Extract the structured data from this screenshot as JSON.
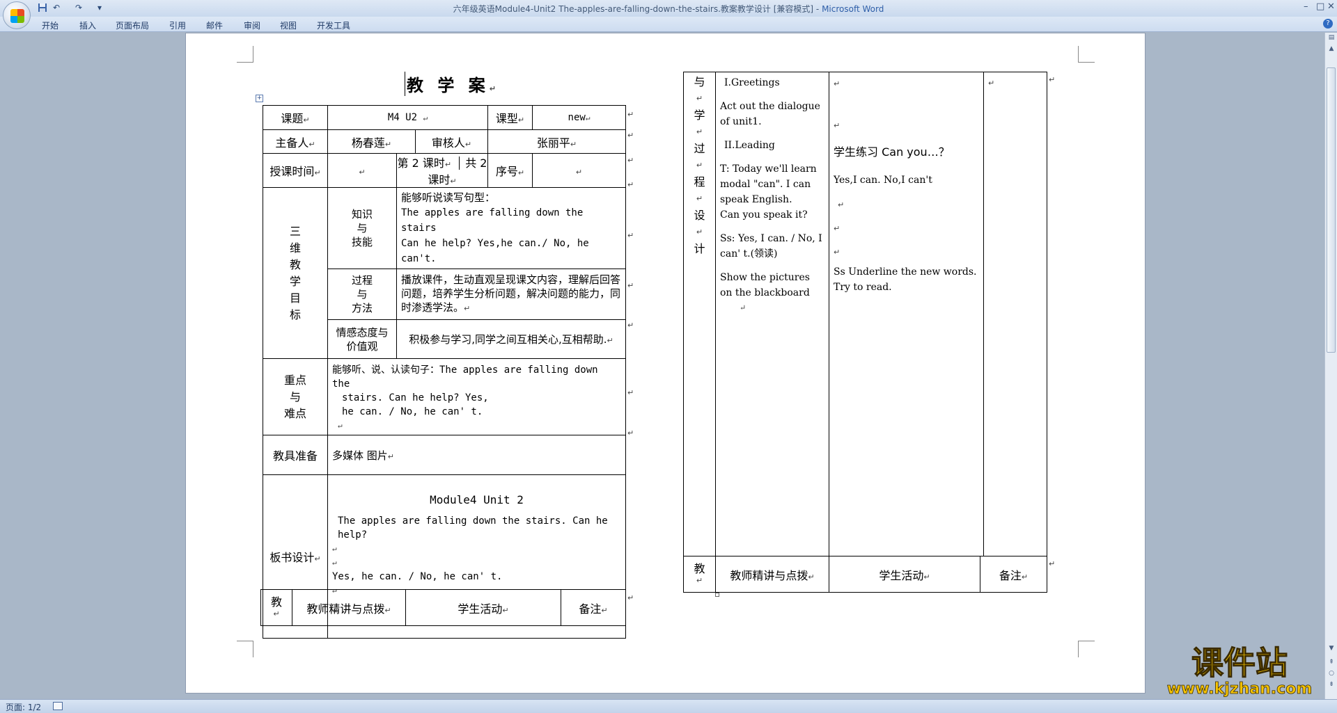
{
  "window": {
    "title_doc": "六年级英语Module4-Unit2 The-apples-are-falling-down-the-stairs.教案教学设计 [兼容模式] - ",
    "title_app": "Microsoft Word"
  },
  "quick_access": {
    "undo": "↶",
    "redo": "↷",
    "dropdown": "▾"
  },
  "window_controls": {
    "minimize": "–",
    "maximize": "□",
    "close": "✕"
  },
  "ribbon": {
    "tabs": [
      "开始",
      "插入",
      "页面布局",
      "引用",
      "邮件",
      "审阅",
      "视图",
      "开发工具"
    ],
    "help": "?"
  },
  "doc": {
    "heading": "教  学  案",
    "left": {
      "topic_label": "课题",
      "topic_value": "M4 U2",
      "type_label": "课型",
      "type_value": "new",
      "preparer_label": "主备人",
      "preparer_value": "杨春莲",
      "reviewer_label": "审核人",
      "reviewer_value": "张丽平",
      "time_label": "授课时间",
      "lesson_no": "第 2 课时",
      "lesson_total": "共 2 课时",
      "seq_label": "序号",
      "goals_label_chars": [
        "三",
        "维",
        "教",
        "学",
        "目",
        "标"
      ],
      "knowledge_label": [
        "知识",
        "与",
        "技能"
      ],
      "knowledge_lines": [
        "能够听说读写句型：",
        "The apples are falling down the stairs",
        "Can he help? Yes,he can./ No, he can't."
      ],
      "process_label": [
        "过程",
        "与",
        "方法"
      ],
      "process_text": "播放课件，生动直观呈现课文内容，理解后回答问题，培养学生分析问题，解决问题的能力，同时渗透学法。",
      "attitude_label": [
        "情感态度与",
        "价值观"
      ],
      "attitude_text": "积极参与学习,同学之间互相关心,互相帮助.",
      "key_label": [
        "重点",
        "与",
        "难点"
      ],
      "key_lines": [
        "能够听、说、认读句子：The apples are falling down the",
        "stairs. Can he help? Yes,",
        "he can. / No, he can' t."
      ],
      "tools_label": "教具准备",
      "tools_value": "多媒体  图片",
      "board_label": "板书设计",
      "board_title": "Module4  Unit 2",
      "board_line1": "The apples are falling down the stairs. Can he help?",
      "board_line2": "Yes, he can. / No, he can' t.",
      "bottom_col1": "教",
      "bottom_col2": "教师精讲与点拨",
      "bottom_col3": "学生活动",
      "bottom_col4": "备注"
    },
    "right": {
      "side_chars": [
        "与",
        "学",
        "过",
        "程",
        "设",
        "计"
      ],
      "teacher_blocks": [
        "I.Greetings",
        "Act out the dialogue of unit1.",
        "II.Leading",
        "T: Today we'll learn modal \"can\". I can speak English.",
        "Can you speak it?",
        "Ss: Yes, I can. / No, I can' t.(领读)",
        "Show the pictures on the  blackboard"
      ],
      "student_blocks": [
        "学生练习 Can you…？",
        "Yes,I can. No,I can't",
        "Ss Underline the new words. Try to read."
      ],
      "bottom_col1": "教",
      "bottom_col2": "教师精讲与点拨",
      "bottom_col3": "学生活动",
      "bottom_col4": "备注"
    }
  },
  "status": {
    "page": "页面: 1/2"
  },
  "watermark": {
    "text": "课件站",
    "url": "www.kjzhan.com"
  }
}
